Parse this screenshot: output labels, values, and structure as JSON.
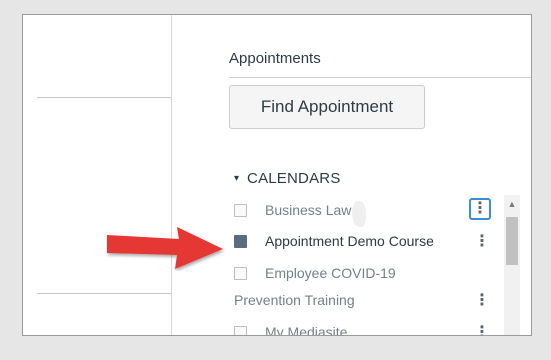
{
  "panel": {
    "title": "Appointments",
    "find_button_label": "Find Appointment"
  },
  "calendars": {
    "toggle_icon": "▾",
    "header": "CALENDARS",
    "items": [
      {
        "label": "Business Law",
        "checked": false,
        "active": false
      },
      {
        "label": "Appointment Demo Course",
        "checked": true,
        "active": true
      },
      {
        "label": "Employee COVID-19",
        "checked": false,
        "active": false
      },
      {
        "label": "Prevention Training",
        "checked": false,
        "active": false
      },
      {
        "label": "My Mediasite",
        "checked": false,
        "active": false
      }
    ]
  },
  "icons": {
    "kebab": "⋮",
    "scroll_up": "▲"
  },
  "colors": {
    "arrow": "#e53935",
    "focus_ring": "#3d8ed0",
    "checked_box": "#5a6d7e",
    "text_dark": "#2d3b45",
    "text_muted": "#73818c"
  }
}
